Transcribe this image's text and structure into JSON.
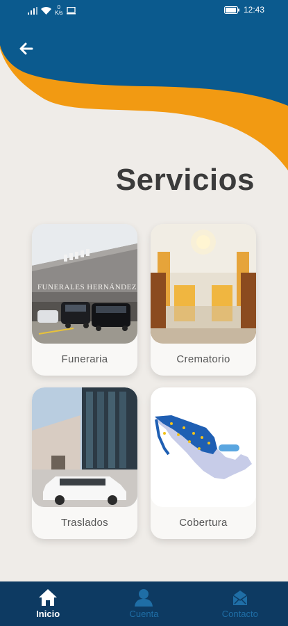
{
  "status_bar": {
    "net_speed_value": "0",
    "net_speed_unit": "K/s",
    "time": "12:43"
  },
  "header": {
    "back_icon": "arrow-left-icon",
    "title": "Servicios"
  },
  "colors": {
    "header_blue": "#0b5a8e",
    "accent_orange": "#f29a12",
    "background": "#efece8",
    "nav_background": "#0d3a62",
    "nav_inactive": "#1f6ea6",
    "title": "#3b3b3b"
  },
  "services": [
    {
      "label": "Funeraria",
      "image": "funeral-home-building-image"
    },
    {
      "label": "Crematorio",
      "image": "crematorium-hall-image"
    },
    {
      "label": "Traslados",
      "image": "hearse-transport-image"
    },
    {
      "label": "Cobertura",
      "image": "mexico-coverage-map-image"
    }
  ],
  "signage": "FUNERALES HERNÁNDEZ",
  "bottom_nav": {
    "items": [
      {
        "label": "Inicio",
        "icon": "home-icon",
        "active": true
      },
      {
        "label": "Cuenta",
        "icon": "user-icon",
        "active": false
      },
      {
        "label": "Contacto",
        "icon": "mail-icon",
        "active": false
      }
    ]
  }
}
